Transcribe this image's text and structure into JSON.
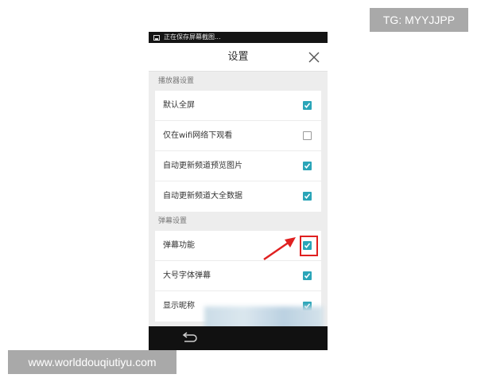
{
  "watermarks": {
    "tg": "TG: MYYJJPP",
    "url": "www.worlddouqiutiyu.com"
  },
  "status_bar": {
    "text": "正在保存屏幕截图...",
    "icon": "image-icon"
  },
  "header": {
    "title": "设置",
    "close_icon": "close-icon"
  },
  "sections": [
    {
      "label": "播放器设置",
      "items": [
        {
          "label": "默认全屏",
          "checked": true
        },
        {
          "label": "仅在wifi网络下观看",
          "checked": false
        },
        {
          "label": "自动更新频道预览图片",
          "checked": true
        },
        {
          "label": "自动更新频道大全数据",
          "checked": true
        }
      ]
    },
    {
      "label": "弹幕设置",
      "items": [
        {
          "label": "弹幕功能",
          "checked": true
        },
        {
          "label": "大号字体弹幕",
          "checked": true
        },
        {
          "label": "显示昵称",
          "checked": true
        }
      ]
    }
  ],
  "colors": {
    "accent": "#2aa5b8",
    "annotation": "#e02020"
  },
  "nav": {
    "back_icon": "back-arrow-icon"
  }
}
